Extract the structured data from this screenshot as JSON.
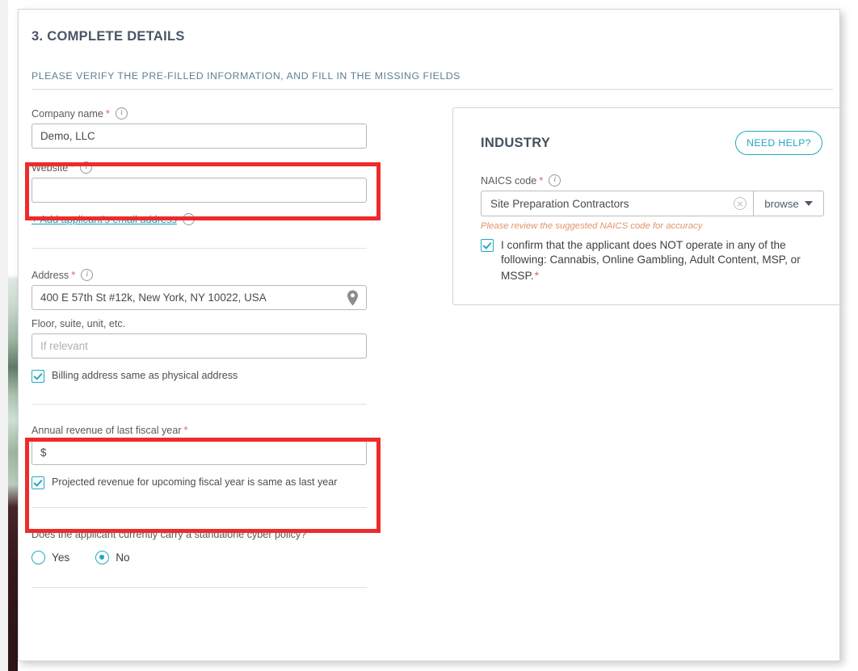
{
  "page": {
    "title": "3. COMPLETE DETAILS",
    "subtitle": "PLEASE VERIFY THE PRE-FILLED INFORMATION, AND FILL IN THE MISSING FIELDS"
  },
  "colors": {
    "accent_teal": "#22a8c0",
    "heading_slate": "#4a5566",
    "subtitle_blue": "#5d7f94",
    "required_red": "#e8605b",
    "highlight_red": "#ee2b2b",
    "hint_orange": "#e39368",
    "link_teal": "#1c9bb5"
  },
  "form": {
    "company_name": {
      "label": "Company name",
      "required_mark": "*",
      "info_icon": "info-icon",
      "value": "Demo, LLC",
      "placeholder": ""
    },
    "website": {
      "label": "Website",
      "required_mark": "*",
      "info_icon": "info-icon",
      "value": "",
      "placeholder": "",
      "highlighted": true
    },
    "add_email_link": {
      "label": "+ Add applicant's email address",
      "info_icon": "info-icon"
    },
    "address": {
      "label": "Address",
      "required_mark": "*",
      "info_icon": "info-icon",
      "value": "400 E 57th St #12k, New York, NY 10022, USA",
      "placeholder": "",
      "pin_icon": "location-pin-icon"
    },
    "floor": {
      "label": "Floor, suite, unit, etc.",
      "value": "",
      "placeholder": "If relevant"
    },
    "billing_same": {
      "label": "Billing address same as physical address",
      "checked": true
    },
    "annual_revenue": {
      "label": "Annual revenue of last fiscal year",
      "required_mark": "*",
      "value": "$",
      "placeholder": "",
      "highlighted": true
    },
    "projected_revenue_same": {
      "label": "Projected revenue for upcoming fiscal year is same as last year",
      "checked": true
    },
    "cyber_policy": {
      "question": "Does the applicant currently carry a standalone cyber policy?",
      "options": [
        {
          "label": "Yes",
          "selected": false
        },
        {
          "label": "No",
          "selected": true
        }
      ]
    }
  },
  "industry": {
    "title": "INDUSTRY",
    "need_help_label": "NEED HELP?",
    "naics": {
      "label": "NAICS code",
      "required_mark": "*",
      "info_icon": "info-icon",
      "value": "Site Preparation Contractors",
      "clear_icon": "clear-circle-icon",
      "browse_label": "browse",
      "caret_icon": "chevron-down-icon",
      "hint": "Please review the suggested NAICS code for accuracy"
    },
    "confirm": {
      "label": "I confirm that the applicant does NOT operate in any of the following: Cannabis, Online Gambling, Adult Content, MSP, or MSSP.",
      "required_mark": "*",
      "checked": true
    }
  }
}
